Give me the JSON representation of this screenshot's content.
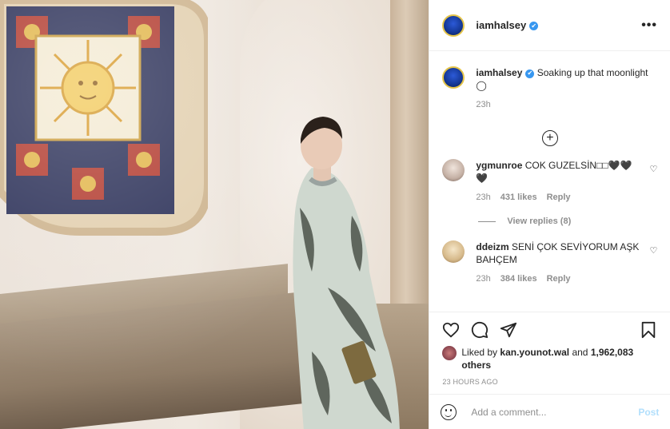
{
  "post": {
    "author": "iamhalsey",
    "verified_mark": "✔",
    "more_icon": "ellipsis-icon",
    "caption": "Soaking up that moonlight ◯",
    "caption_time": "23h"
  },
  "comments": [
    {
      "username": "ygmunroe",
      "text": "COK GUZELSİN□□🖤🖤🖤",
      "time": "23h",
      "likes": "431 likes",
      "reply": "Reply",
      "view_replies": "View replies (8)"
    },
    {
      "username": "ddeizm",
      "text": "SENİ ÇOK SEVİYORUM AŞK BAHÇEM",
      "time": "23h",
      "likes": "384 likes",
      "reply": "Reply"
    }
  ],
  "likes": {
    "prefix": "Liked by",
    "liker": "kan.younot.wal",
    "and": "and",
    "others": "1,962,083 others"
  },
  "timestamp": "23 HOURS AGO",
  "add_comment": {
    "placeholder": "Add a comment...",
    "post_label": "Post"
  },
  "icons": {
    "like": "heart-icon",
    "comment": "comment-icon",
    "share": "paper-plane-icon",
    "save": "bookmark-icon",
    "emoji": "smiley-icon",
    "add": "plus-circle-icon"
  },
  "colors": {
    "link_blue": "#3897f0",
    "post_disabled": "#b2dffc",
    "muted": "#8e8e8e",
    "text": "#262626"
  }
}
